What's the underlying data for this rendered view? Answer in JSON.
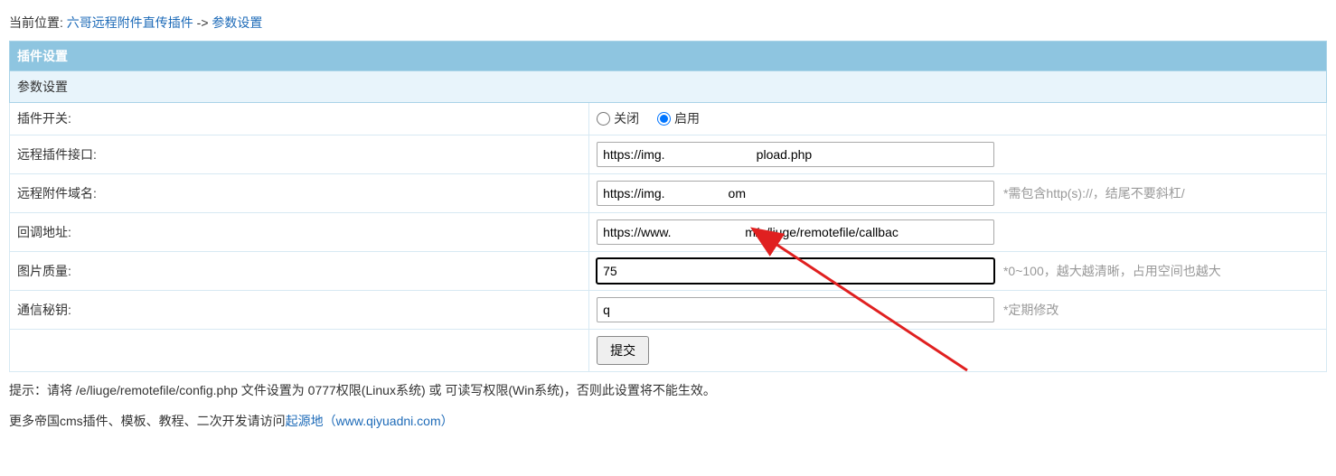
{
  "breadcrumb": {
    "label": "当前位置:",
    "link1": "六哥远程附件直传插件",
    "sep": "->",
    "link2": "参数设置"
  },
  "headers": {
    "plugin_settings": "插件设置",
    "param_settings": "参数设置"
  },
  "rows": {
    "switch": {
      "label": "插件开关:",
      "off": "关闭",
      "on": "启用"
    },
    "remote_api": {
      "label": "远程插件接口:",
      "value": "https://img.                          pload.php"
    },
    "remote_domain": {
      "label": "远程附件域名:",
      "value": "https://img.                  om",
      "hint": "*需包含http(s)://，结尾不要斜杠/"
    },
    "callback": {
      "label": "回调地址:",
      "value": "https://www.                     m/e/liuge/remotefile/callbac"
    },
    "quality": {
      "label": "图片质量:",
      "value": "75",
      "hint": "*0~100，越大越清晰，占用空间也越大"
    },
    "secret": {
      "label": "通信秘钥:",
      "value": "q        ",
      "hint": "*定期修改"
    },
    "submit": "提交"
  },
  "tip": "提示：请将 /e/liuge/remotefile/config.php 文件设置为 0777权限(Linux系统) 或 可读写权限(Win系统)，否则此设置将不能生效。",
  "more": {
    "prefix": "更多帝国cms插件、模板、教程、二次开发请访问",
    "link": "起源地（www.qiyuadni.com）"
  }
}
